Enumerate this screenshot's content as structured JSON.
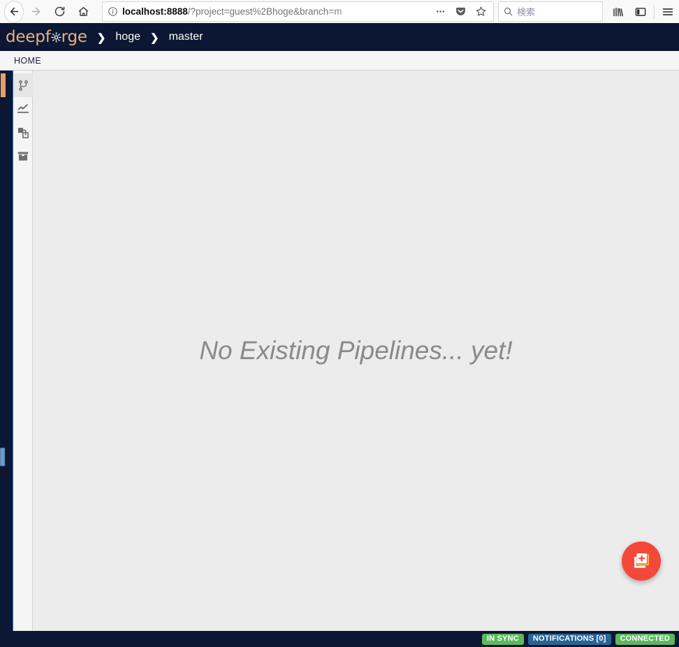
{
  "browser": {
    "back_label": "Back",
    "forward_label": "Forward",
    "reload_label": "Reload",
    "home_label": "Home",
    "url": {
      "host": "localhost:8888",
      "path": "/?project=guest%2Bhoge&branch=m",
      "identity_icon": "info-circle-icon"
    },
    "page_actions_label": "…",
    "pocket_label": "Save to Pocket",
    "bookmark_label": "Bookmark this page",
    "search": {
      "placeholder": "検索",
      "icon": "search-icon"
    },
    "library_label": "Library",
    "sidebar_label": "Sidebars",
    "menu_label": "Open menu"
  },
  "app": {
    "logo": {
      "prefix": "deepf",
      "suffix": "rge",
      "gear_icon": "gear-icon",
      "color": "#e8b17c"
    },
    "breadcrumb": {
      "separator": "❯",
      "items": [
        {
          "label": "hoge"
        },
        {
          "label": "master"
        }
      ]
    },
    "tabs": [
      {
        "label": "HOME",
        "active": true
      }
    ],
    "sidebar": {
      "items": [
        {
          "name": "pipelines",
          "icon": "git-branch-icon",
          "active": true
        },
        {
          "name": "executions",
          "icon": "line-chart-icon",
          "active": false
        },
        {
          "name": "artifacts",
          "icon": "layers-icon",
          "active": false
        },
        {
          "name": "archive",
          "icon": "archive-box-icon",
          "active": false
        }
      ]
    },
    "main": {
      "empty_message": "No Existing Pipelines... yet!",
      "fab": {
        "label": "Create new pipeline",
        "icon": "add-document-icon",
        "color": "#f4483a"
      }
    },
    "statusbar": {
      "badges": [
        {
          "label": "IN SYNC",
          "color": "#5cb85c",
          "style": "green"
        },
        {
          "label": "NOTIFICATIONS [0]",
          "color": "#2a6496",
          "style": "blue"
        },
        {
          "label": "CONNECTED",
          "color": "#5cb85c",
          "style": "green"
        }
      ]
    }
  }
}
